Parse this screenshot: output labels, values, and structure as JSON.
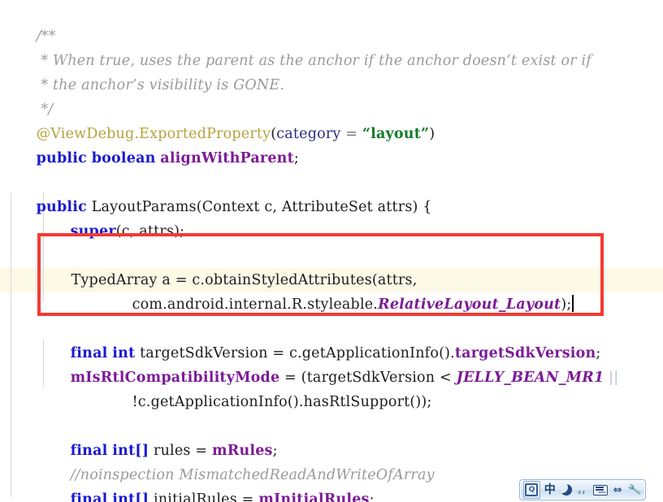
{
  "editor": {
    "background_color": "#ffffff",
    "caret_line_highlight_color": "#fdf9e7",
    "annotation_box_color": "#f33b33",
    "lines": [
      {
        "id": "l1",
        "indent": 0,
        "text": "/**"
      },
      {
        "id": "l2",
        "indent": 0,
        "text": " * When true, uses the parent as the anchor if the anchor doesn't exist or if"
      },
      {
        "id": "l3",
        "indent": 0,
        "text": " * the anchor's visibility is GONE."
      },
      {
        "id": "l4",
        "indent": 0,
        "text": " */"
      },
      {
        "id": "l5",
        "indent": 0,
        "text": "@ViewDebug.ExportedProperty(category = \"layout\")"
      },
      {
        "id": "l6",
        "indent": 0,
        "text": "public boolean alignWithParent;"
      },
      {
        "id": "l7",
        "indent": 0,
        "text": ""
      },
      {
        "id": "l8",
        "indent": 0,
        "text": "public LayoutParams(Context c, AttributeSet attrs) {"
      },
      {
        "id": "l9",
        "indent": 1,
        "text": "super(c, attrs);"
      },
      {
        "id": "l10",
        "indent": 0,
        "text": ""
      },
      {
        "id": "l11",
        "indent": 1,
        "text": "TypedArray a = c.obtainStyledAttributes(attrs,"
      },
      {
        "id": "l12",
        "indent": 3,
        "text": "com.android.internal.R.styleable.RelativeLayout_Layout);"
      },
      {
        "id": "l13",
        "indent": 0,
        "text": ""
      },
      {
        "id": "l14",
        "indent": 1,
        "text": "final int targetSdkVersion = c.getApplicationInfo().targetSdkVersion;"
      },
      {
        "id": "l15",
        "indent": 1,
        "text": "mIsRtlCompatibilityMode = (targetSdkVersion < JELLY_BEAN_MR1 ||"
      },
      {
        "id": "l16",
        "indent": 3,
        "text": "!c.getApplicationInfo().hasRtlSupport());"
      },
      {
        "id": "l17",
        "indent": 0,
        "text": ""
      },
      {
        "id": "l18",
        "indent": 1,
        "text": "final int[] rules = mRules;"
      },
      {
        "id": "l19",
        "indent": 1,
        "text": "//noinspection MismatchedReadAndWriteOfArray"
      },
      {
        "id": "l20",
        "indent": 1,
        "text": "final int[] initialRules = mInitialRules;"
      }
    ],
    "tokens": {
      "javadoc_open": "/**",
      "javadoc_line1": " * When true, uses the parent as the anchor if the anchor doesn’t exist or if",
      "javadoc_line2": " * the anchor’s visibility is GONE.",
      "javadoc_close": " */",
      "annotation_name": "@ViewDebug.ExportedProperty",
      "annotation_open_paren": "(",
      "annotation_param": "category",
      "annotation_eq": " = ",
      "annotation_value": "“layout”",
      "annotation_close_paren": ")",
      "kw_public": "public",
      "kw_boolean": "boolean",
      "field_alignWithParent": "alignWithParent",
      "semi": ";",
      "ctor_name": "LayoutParams",
      "ctor_sig": "(Context c, AttributeSet attrs) {",
      "kw_super": "super",
      "super_args": "(c, attrs);",
      "typedarray_decl": "TypedArray a = c.obtainStyledAttributes(attrs,",
      "styleable_prefix": "com.android.internal.R.styleable.",
      "styleable_const": "RelativeLayout_Layout",
      "styleable_tail": ");",
      "kw_final": "final",
      "kw_int": "int",
      "var_targetSdkVersion": "targetSdkVersion",
      "eq_getappinfo": " = c.getApplicationInfo().",
      "fld_targetSdkVersion": "targetSdkVersion",
      "fld_mIsRtlCompatibilityMode": "mIsRtlCompatibilityMode",
      "rtl_expr_open": " = (targetSdkVersion < ",
      "const_jelly": "JELLY_BEAN_MR1",
      "or_operator": "||",
      "rtl_expr_tail": "!c.getApplicationInfo().hasRtlSupport());",
      "int_array": "int[]",
      "var_rules": " rules = ",
      "fld_mRules": "mRules",
      "comment_noinspection": "//noinspection MismatchedReadAndWriteOfArray",
      "var_initialRules": " initialRules = ",
      "fld_mInitialRules": "mInitialRules"
    },
    "syntax_colors": {
      "keyword": "#1a1ad0",
      "comment": "#9a9a9a",
      "annotation": "#b3a33c",
      "string": "#147a2a",
      "field": "#7c1c96",
      "static_constant": "#7c1c96",
      "plain": "#1c1c1c"
    }
  },
  "ime_toolbar": {
    "name": "chinese-ime-floating-bar",
    "buttons": [
      {
        "id": "logo",
        "icon": "ime-logo-icon",
        "label": "Q"
      },
      {
        "id": "lang-mode",
        "icon": "chinese-mode-icon",
        "label": "中"
      },
      {
        "id": "moon",
        "icon": "crescent-moon-icon",
        "label": ""
      },
      {
        "id": "punctuation",
        "icon": "punctuation-mode-icon",
        "label": "。，"
      },
      {
        "id": "soft-kbd",
        "icon": "soft-keyboard-icon",
        "label": ""
      },
      {
        "id": "width-mode",
        "icon": "half-full-width-icon",
        "label": "⇔"
      },
      {
        "id": "settings",
        "icon": "wrench-icon",
        "label": "🔧"
      }
    ]
  }
}
